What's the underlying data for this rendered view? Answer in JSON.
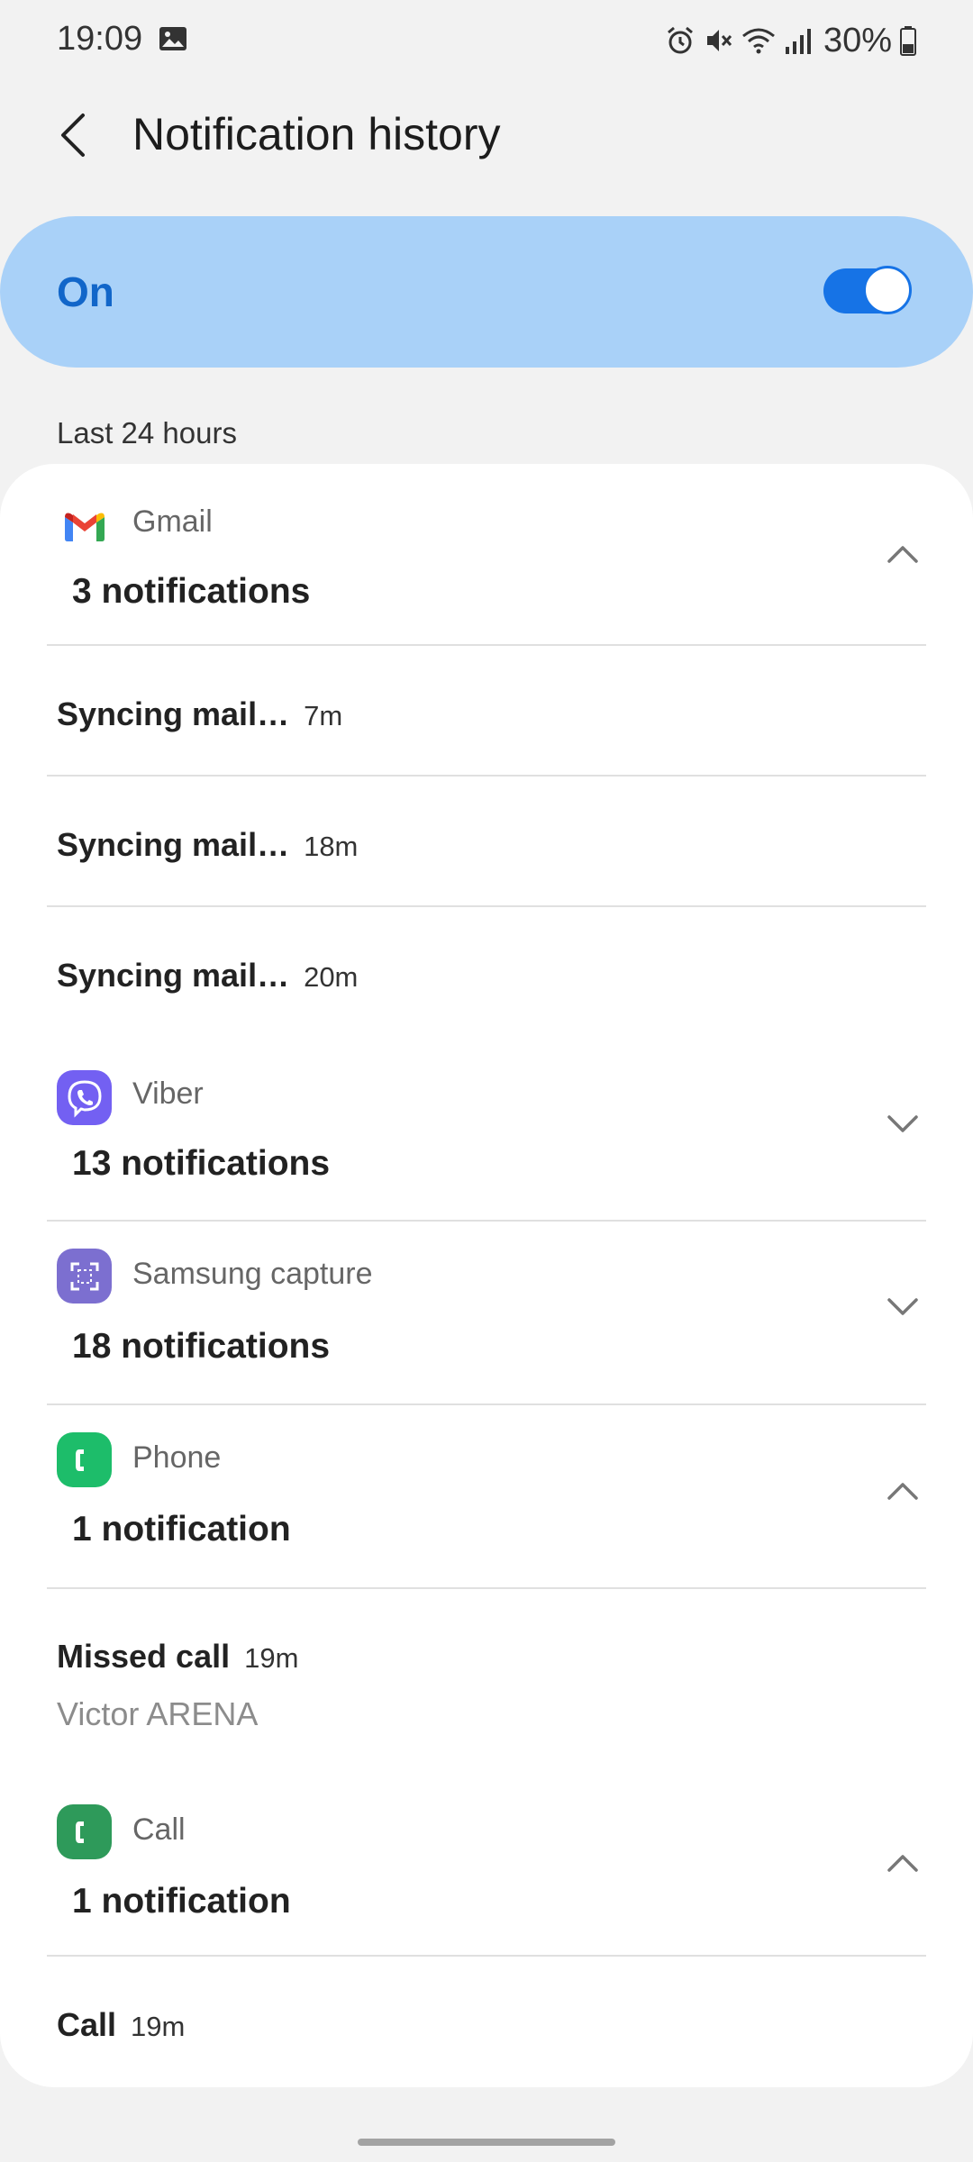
{
  "status_bar": {
    "time": "19:09",
    "battery": "30%"
  },
  "header": {
    "title": "Notification history"
  },
  "master": {
    "label": "On",
    "enabled": true
  },
  "section": {
    "label": "Last 24 hours"
  },
  "apps": {
    "gmail": {
      "name": "Gmail",
      "count": "3 notifications",
      "items": [
        {
          "title": "Syncing mail…",
          "time": "7m"
        },
        {
          "title": "Syncing mail…",
          "time": "18m"
        },
        {
          "title": "Syncing mail…",
          "time": "20m"
        }
      ]
    },
    "viber": {
      "name": "Viber",
      "count": "13 notifications"
    },
    "samsung_capture": {
      "name": "Samsung capture",
      "count": "18 notifications"
    },
    "phone": {
      "name": "Phone",
      "count": "1 notification",
      "items": [
        {
          "title": "Missed call",
          "time": "19m",
          "subtitle": "Victor ARENA"
        }
      ]
    },
    "call": {
      "name": "Call",
      "count": "1 notification",
      "items": [
        {
          "title": "Call",
          "time": "19m"
        }
      ]
    }
  },
  "colors": {
    "accent": "#1673e6",
    "toggle_card": "#a9d1f8",
    "viber": "#7360f2",
    "samsung_capture": "#7c6fd0",
    "phone": "#1dbd6a",
    "call": "#2e9a5a"
  }
}
